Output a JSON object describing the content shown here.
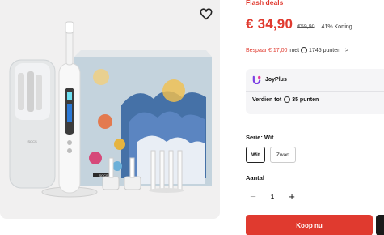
{
  "product": {
    "flash_label": "Flash deals",
    "price": "€ 34,90",
    "old_price": "€59,90",
    "discount": "41% Korting",
    "save_amount": "Bespaar € 17,00",
    "save_mid": "met",
    "save_points": "1745 punten",
    "save_chevron": ">"
  },
  "joyplus": {
    "brand": "JoyPlus",
    "earn_prefix": "Verdien tot",
    "earn_points": "35 punten"
  },
  "variants": {
    "label": "Serie: Wit",
    "options": [
      "Wit",
      "Zwart"
    ],
    "selected": "Wit"
  },
  "quantity": {
    "label": "Aantal",
    "value": "1",
    "minus": "−",
    "plus": "+"
  },
  "actions": {
    "buy_label": "Koop nu"
  },
  "image": {
    "box_brand": "SOCS",
    "favorite_icon": "heart-outline-icon"
  },
  "colors": {
    "accent_red": "#e03a2f",
    "panel_gray": "#f1f0f0"
  }
}
